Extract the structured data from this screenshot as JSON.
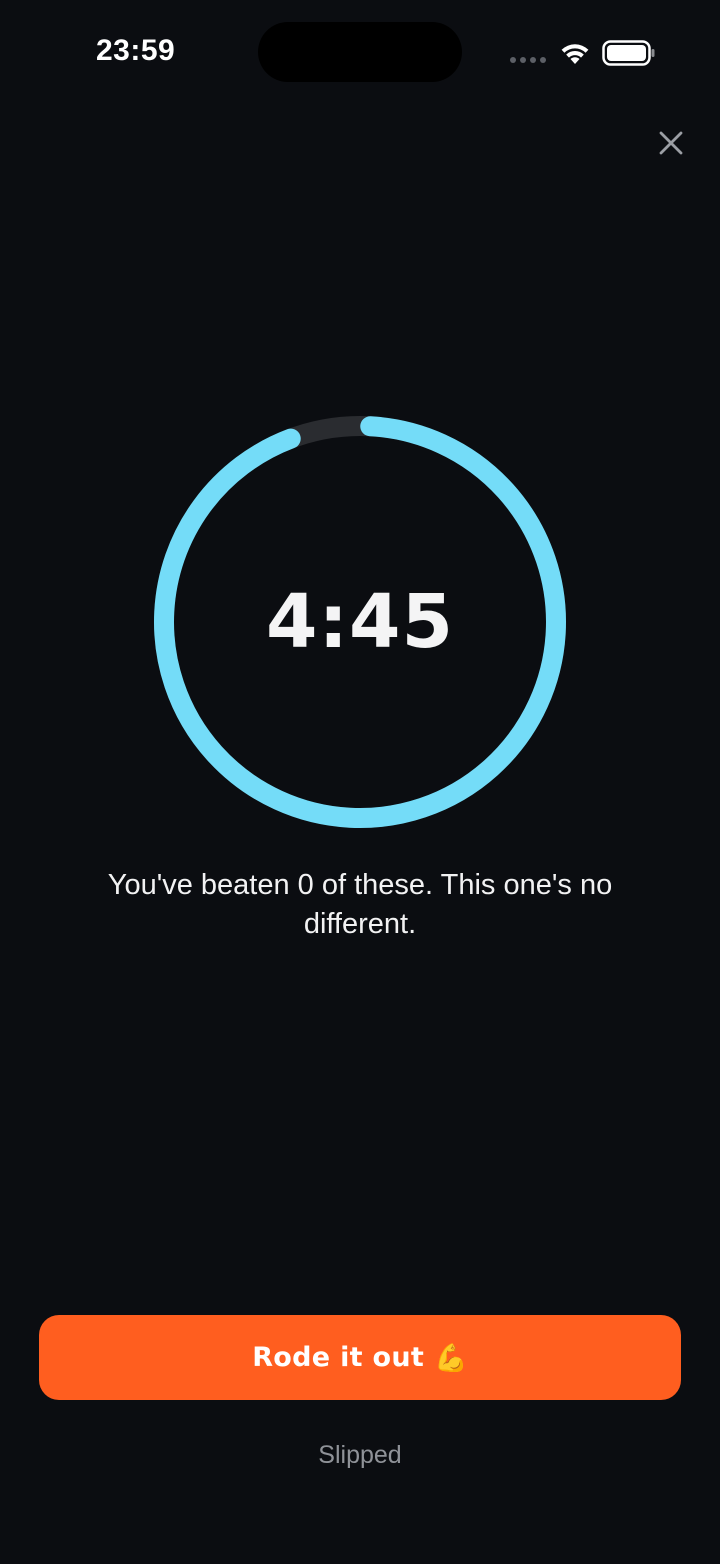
{
  "status_bar": {
    "time": "23:59",
    "icons": [
      "signal-dots-icon",
      "wifi-icon",
      "battery-icon"
    ]
  },
  "header": {
    "close_icon": "close-icon"
  },
  "timer": {
    "display": "4:45",
    "progress_fraction": 0.95,
    "ring_color": "#74dcf8",
    "track_color": "#2a2c30"
  },
  "message": {
    "text": "You've beaten 0 of these. This one's no different."
  },
  "actions": {
    "primary_label": "Rode it out",
    "primary_emoji": "💪",
    "primary_color": "#ff5e1f",
    "secondary_label": "Slipped"
  }
}
